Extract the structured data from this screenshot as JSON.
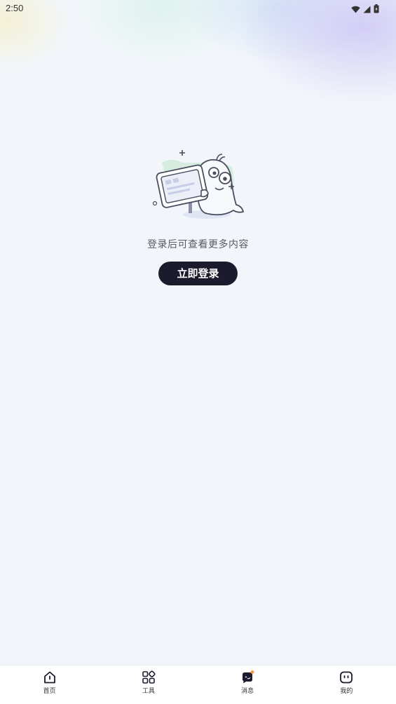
{
  "status_bar": {
    "time": "2:50",
    "icons": [
      "wifi-icon",
      "cellular-signal-icon",
      "battery-icon"
    ]
  },
  "empty_state": {
    "illustration": "mascot-holding-sign-illustration",
    "message": "登录后可查看更多内容",
    "login_button_label": "立即登录"
  },
  "tab_bar": {
    "tabs": [
      {
        "label": "首页",
        "icon": "home-icon"
      },
      {
        "label": "工具",
        "icon": "grid-tools-icon"
      },
      {
        "label": "消息",
        "icon": "message-icon",
        "active": true,
        "badge_dot": true
      },
      {
        "label": "我的",
        "icon": "profile-face-icon"
      }
    ]
  },
  "colors": {
    "background": "#f2f6fa",
    "button": "#1c1b2e",
    "badge": "#f39a4b"
  }
}
